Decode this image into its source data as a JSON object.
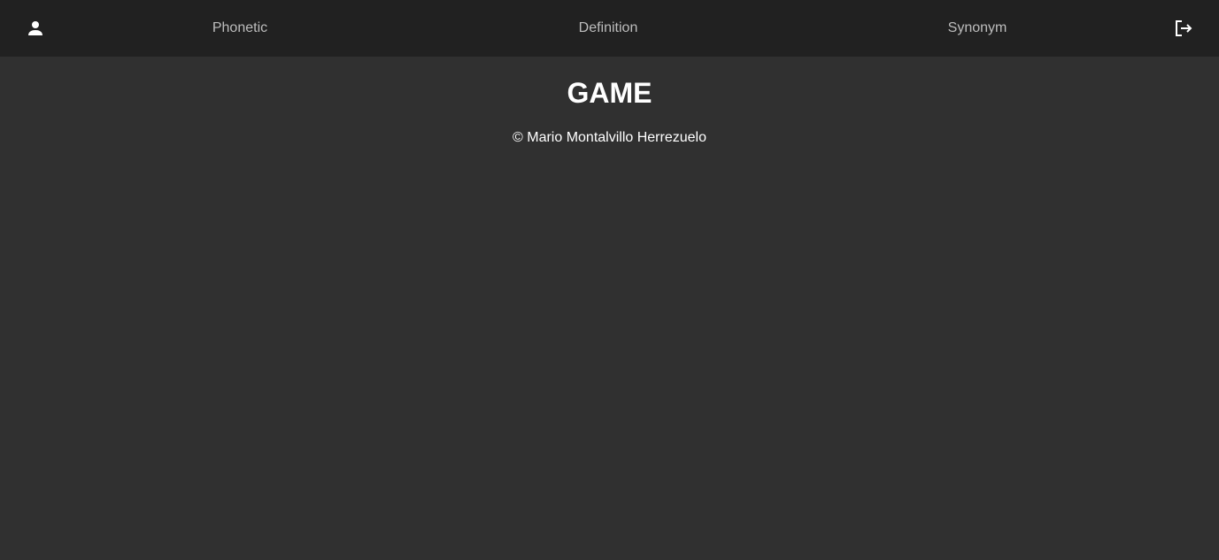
{
  "navbar": {
    "user_icon": "person-icon",
    "logout_icon": "logout-icon",
    "links": [
      {
        "label": "Phonetic"
      },
      {
        "label": "Definition"
      },
      {
        "label": "Synonym"
      }
    ]
  },
  "main": {
    "title": "GAME",
    "copyright": "© Mario Montalvillo Herrezuelo"
  },
  "colors": {
    "navbar_bg": "#212121",
    "page_bg": "#303030",
    "nav_text": "#bdbdbd",
    "text": "#ffffff"
  }
}
